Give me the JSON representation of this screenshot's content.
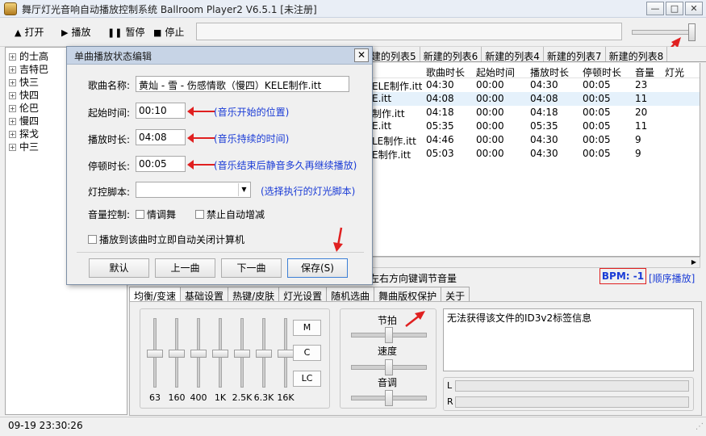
{
  "window": {
    "title": "舞厅灯光音响自动播放控制系统 Ballroom Player2 V6.5.1 [未注册]",
    "min_symbol": "—",
    "max_symbol": "□",
    "close_symbol": "✕"
  },
  "toolbar": {
    "open_label": "打开",
    "play_label": "播放",
    "pause_label": "暂停",
    "stop_label": "停止"
  },
  "tree": {
    "items": [
      "的士高",
      "吉特巴",
      "快三",
      "快四",
      "伦巴",
      "慢四",
      "探戈",
      "中三"
    ]
  },
  "playlist_tabs": [
    "建的列表5",
    "新建的列表6",
    "新建的列表4",
    "新建的列表7",
    "新建的列表8"
  ],
  "list": {
    "headers": [
      "",
      "歌曲时长",
      "起始时间",
      "播放时长",
      "停顿时长",
      "音量",
      "灯光"
    ],
    "rows": [
      {
        "name": "ELE制作.itt",
        "duration": "04:30",
        "start": "00:00",
        "play": "04:30",
        "pause": "00:05",
        "volume": "23"
      },
      {
        "name": "E.itt",
        "duration": "04:08",
        "start": "00:00",
        "play": "04:08",
        "pause": "00:05",
        "volume": "11"
      },
      {
        "name": "制作.itt",
        "duration": "04:18",
        "start": "00:00",
        "play": "04:18",
        "pause": "00:05",
        "volume": "20"
      },
      {
        "name": "E.itt",
        "duration": "05:35",
        "start": "00:00",
        "play": "05:35",
        "pause": "00:05",
        "volume": "11"
      },
      {
        "name": "LE制作.itt",
        "duration": "04:46",
        "start": "00:00",
        "play": "04:30",
        "pause": "00:05",
        "volume": "9"
      },
      {
        "name": "E制作.itt",
        "duration": "05:03",
        "start": "00:00",
        "play": "04:30",
        "pause": "00:05",
        "volume": "9"
      }
    ]
  },
  "status": {
    "hint": "左右方向键调节音量",
    "bpm": "BPM: -1",
    "play_mode": "[顺序播放]"
  },
  "bottom_tabs": [
    "均衡/变速",
    "基础设置",
    "热键/皮肤",
    "灯光设置",
    "随机选曲",
    "舞曲版权保护",
    "关于"
  ],
  "equalizer": {
    "bands": [
      "63",
      "160",
      "400",
      "1K",
      "2.5K",
      "6.3K",
      "16K"
    ],
    "m_label": "M",
    "c_label": "C",
    "lc_label": "LC"
  },
  "sliders": {
    "beat_label": "节拍",
    "speed_label": "速度",
    "pitch_label": "音调"
  },
  "info": {
    "text": "无法获得该文件的ID3v2标签信息",
    "l_label": "L",
    "r_label": "R"
  },
  "statusbar": {
    "datetime": "09-19 23:30:26"
  },
  "dialog": {
    "title": "单曲播放状态编辑",
    "close_symbol": "✕",
    "song_label": "歌曲名称:",
    "song_value": "黄灿 - 雪 - 伤感情歌（慢四）KELE制作.itt",
    "start_label": "起始时间:",
    "start_value": "00:10",
    "start_note": "(音乐开始的位置)",
    "play_label": "播放时长:",
    "play_value": "04:08",
    "play_note": "(音乐持续的时间)",
    "pause_label": "停顿时长:",
    "pause_value": "00:05",
    "pause_note": "(音乐结束后静音多久再继续播放)",
    "light_label": "灯控脚本:",
    "light_value": "",
    "light_note": "(选择执行的灯光脚本)",
    "volume_label": "音量控制:",
    "chk_fine": "情调舞",
    "chk_no_auto": "禁止自动增减",
    "chk_shutdown": "播放到该曲时立即自动关闭计算机",
    "btn_default": "默认",
    "btn_prev": "上一曲",
    "btn_next": "下一曲",
    "btn_save": "保存(S)"
  },
  "colors": {
    "annotation_red": "#e02020",
    "note_blue": "#1a3bd6"
  }
}
